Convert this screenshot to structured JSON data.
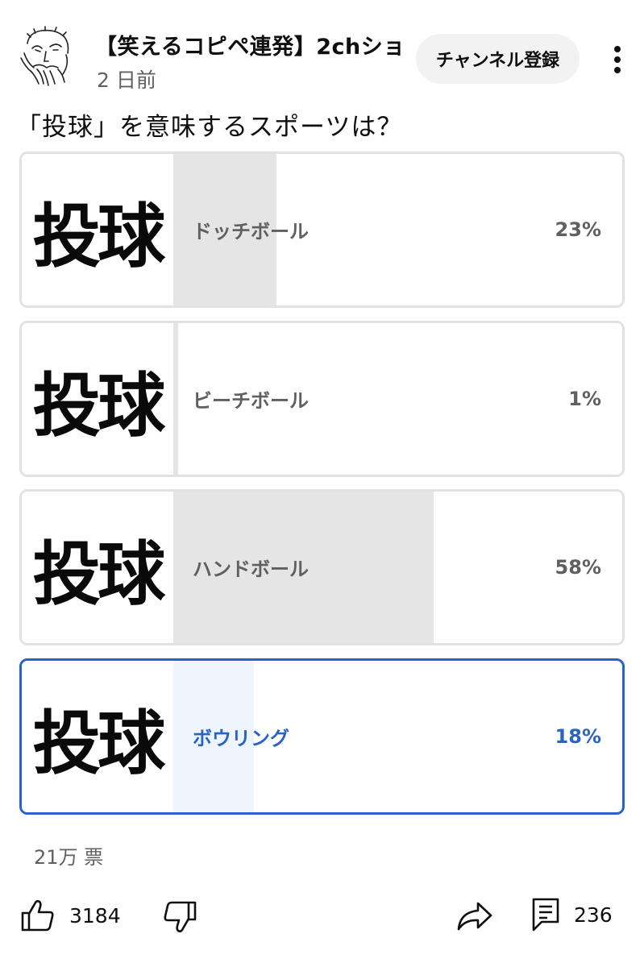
{
  "header": {
    "channel_name": "【笑えるコピペ連発】2chショ…",
    "post_time": "2 日前",
    "subscribe_label": "チャンネル登録"
  },
  "poll": {
    "question": "「投球」を意味するスポーツは？",
    "options": [
      {
        "thumb_text": "投球",
        "label": "ドッチボール",
        "percent_text": "23%",
        "percent": 23,
        "selected": false
      },
      {
        "thumb_text": "投球",
        "label": "ビーチボール",
        "percent_text": "1%",
        "percent": 1,
        "selected": false
      },
      {
        "thumb_text": "投球",
        "label": "ハンドボール",
        "percent_text": "58%",
        "percent": 58,
        "selected": false
      },
      {
        "thumb_text": "投球",
        "label": "ボウリング",
        "percent_text": "18%",
        "percent": 18,
        "selected": true
      }
    ],
    "votes": "21万 票"
  },
  "actions": {
    "like_count": "3184",
    "comment_count": "236"
  },
  "colors": {
    "selected_accent": "#2b63c4",
    "fill_gray": "#e5e5e5",
    "fill_selected": "#eef5fd"
  },
  "icons": {
    "menu": "more-vertical-icon",
    "like": "thumbs-up-icon",
    "dislike": "thumbs-down-icon",
    "share": "share-icon",
    "comment": "comment-icon"
  }
}
